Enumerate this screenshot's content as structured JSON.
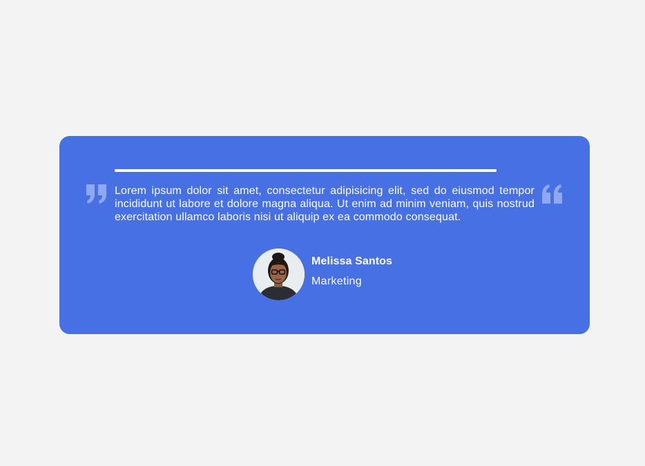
{
  "testimonial": {
    "quote": "Lorem ipsum dolor sit amet, consectetur adipisicing elit, sed do eiusmod tempor incididunt ut labore et dolore magna aliqua. Ut enim ad minim veniam, quis nostrud exercitation ullamco laboris nisi ut aliquip ex ea commodo consequat.",
    "author_name": "Melissa Santos",
    "author_role": "Marketing"
  },
  "icons": {
    "left": "closing-quote-icon",
    "right": "opening-quote-icon",
    "avatar": "avatar-photo"
  },
  "colors": {
    "page_background": "#f3f3f4",
    "card_background": "#4870e5",
    "text": "#ffffff",
    "quote_icon": "#8ea8f2"
  }
}
